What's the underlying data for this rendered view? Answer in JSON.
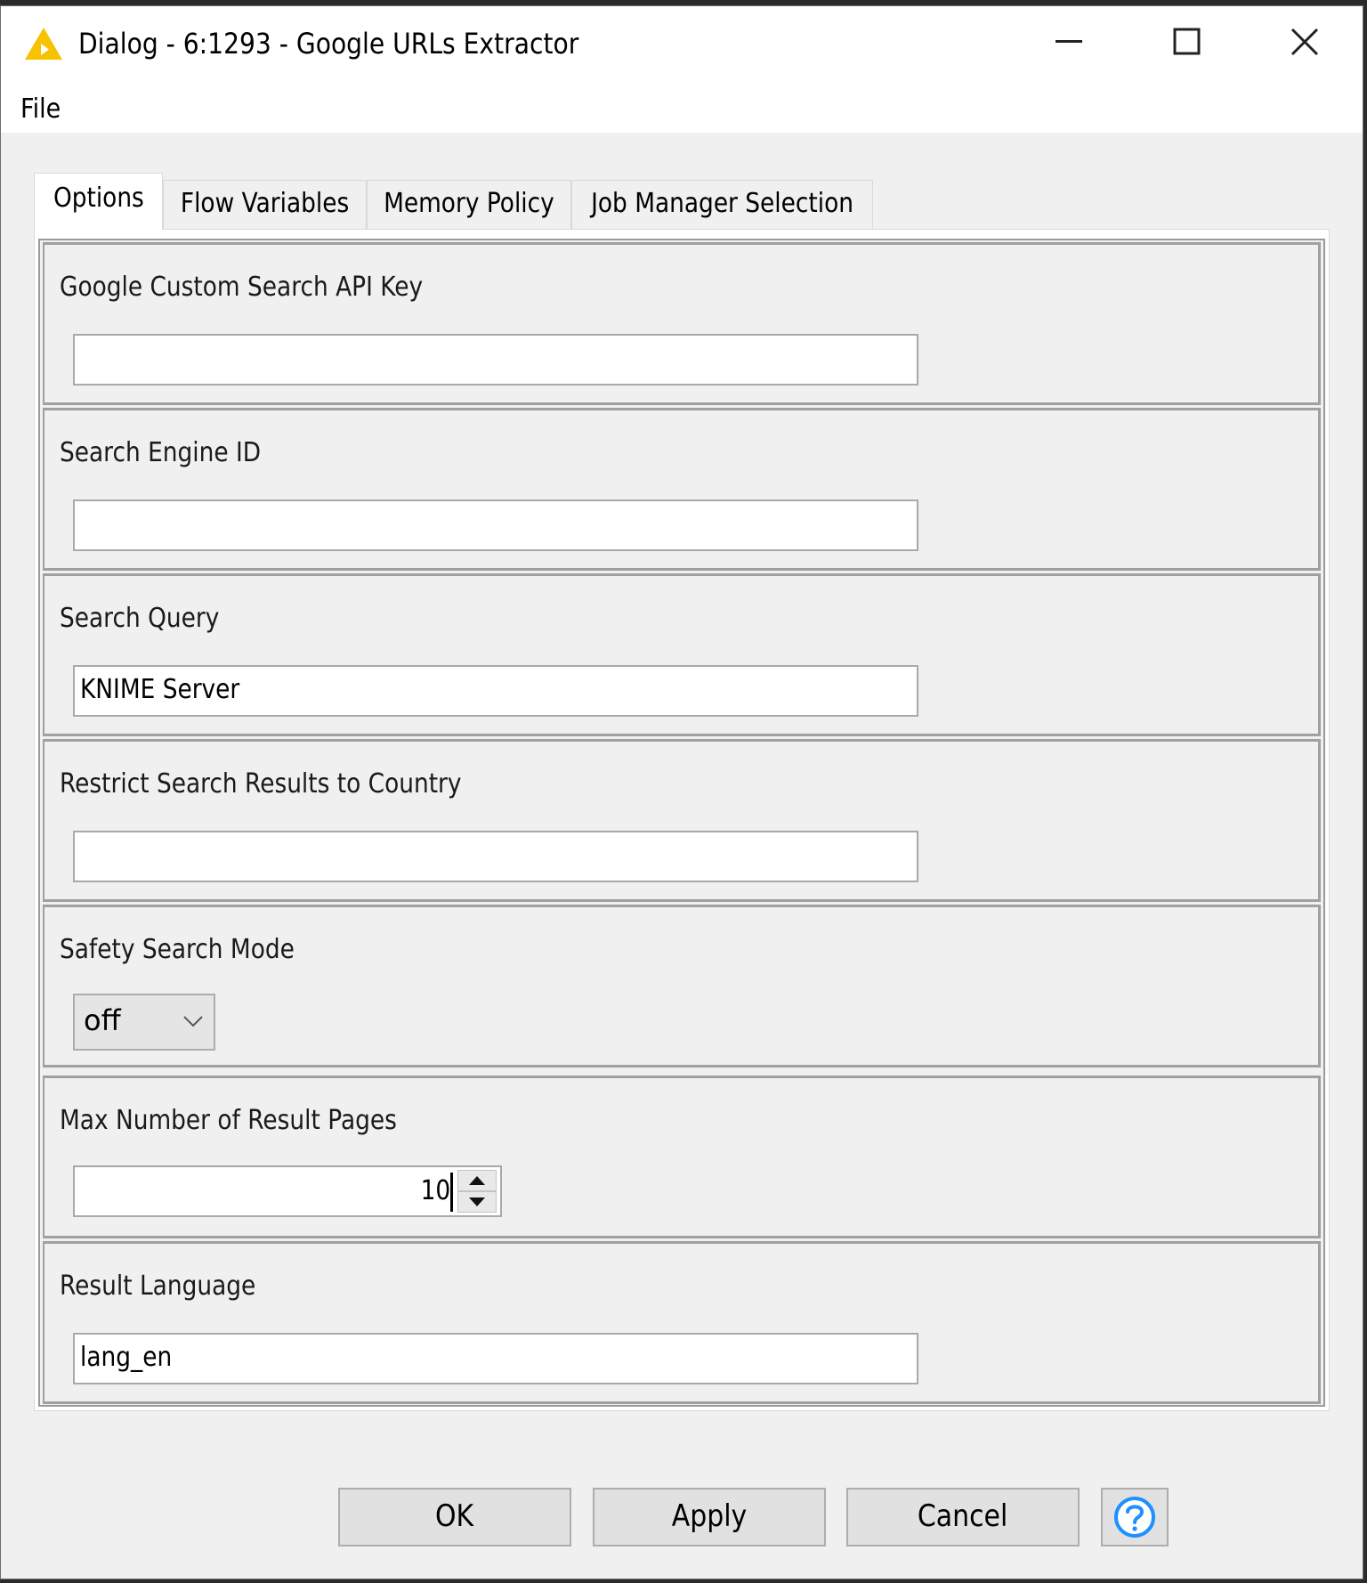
{
  "window": {
    "title": "Dialog - 6:1293 - Google URLs Extractor",
    "icon": "knime-triangle-icon",
    "controls": [
      "minimize-icon",
      "maximize-icon",
      "close-icon"
    ]
  },
  "menu": {
    "items": [
      {
        "label": "File"
      }
    ]
  },
  "tabs": [
    {
      "label": "Options",
      "active": true
    },
    {
      "label": "Flow Variables",
      "active": false
    },
    {
      "label": "Memory Policy",
      "active": false
    },
    {
      "label": "Job Manager Selection",
      "active": false
    }
  ],
  "options": {
    "api_key": {
      "label": "Google Custom Search API Key",
      "value": ""
    },
    "search_engine_id": {
      "label": "Search Engine ID",
      "value": ""
    },
    "search_query": {
      "label": "Search Query",
      "value": "KNIME Server"
    },
    "country": {
      "label": "Restrict Search Results to Country",
      "value": ""
    },
    "safety_mode": {
      "label": "Safety Search Mode",
      "selected": "off"
    },
    "max_pages": {
      "label": "Max Number of Result Pages",
      "value": "10"
    },
    "language": {
      "label": "Result Language",
      "value": "lang_en"
    }
  },
  "buttons": {
    "ok": "OK",
    "apply": "Apply",
    "cancel": "Cancel",
    "help_icon": "help-question-icon"
  },
  "colors": {
    "knime_yellow": "#f7c200",
    "help_blue": "#1e90ff",
    "dialog_bg": "#f0f0f0"
  }
}
